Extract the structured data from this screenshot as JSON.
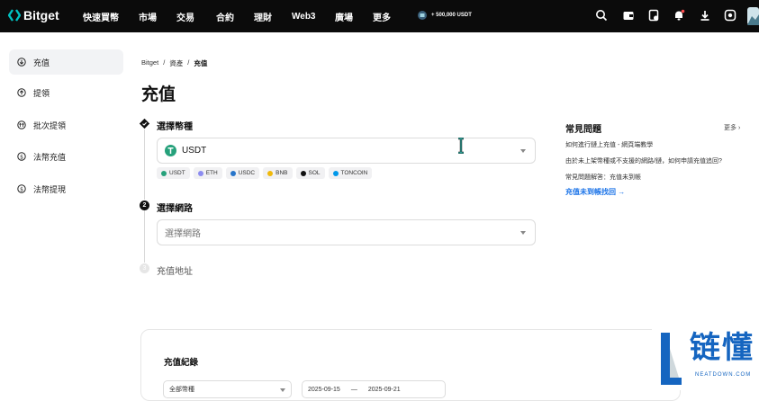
{
  "colors": {
    "topbar_bg": "#0b0b0b",
    "accent": "#00c2c2",
    "usdt": "#26a17b",
    "link": "#1a73e8",
    "watermark": "#1565c0"
  },
  "topbar": {
    "logo_text": "Bitget",
    "nav": [
      "快速買幣",
      "市場",
      "交易",
      "合約",
      "理財",
      "Web3",
      "廣場",
      "更多"
    ],
    "promo": "+ 500,000 USDT",
    "icons": [
      "search-icon",
      "wallet-icon",
      "orders-icon",
      "bell-icon",
      "download-icon",
      "globe-icon",
      "avatar"
    ]
  },
  "sidebar": {
    "items": [
      {
        "label": "充值",
        "icon": "deposit-icon"
      },
      {
        "label": "提領",
        "icon": "withdraw-icon"
      },
      {
        "label": "批次提領",
        "icon": "batch-withdraw-icon"
      },
      {
        "label": "法幣充值",
        "icon": "fiat-deposit-icon"
      },
      {
        "label": "法幣提現",
        "icon": "fiat-withdraw-icon"
      }
    ]
  },
  "breadcrumb": {
    "items": [
      "Bitget",
      "資產",
      "充值"
    ]
  },
  "page_title": "充值",
  "steps": {
    "coin": {
      "label": "選擇幣種",
      "selected": "USDT",
      "chips": [
        {
          "label": "USDT",
          "color": "#26a17b"
        },
        {
          "label": "ETH",
          "color": "#8c8cf0"
        },
        {
          "label": "USDC",
          "color": "#2775ca"
        },
        {
          "label": "BNB",
          "color": "#f0b90b"
        },
        {
          "label": "SOL",
          "color": "#111111"
        },
        {
          "label": "TONCOIN",
          "color": "#0098ea"
        }
      ]
    },
    "network": {
      "label": "選擇網路",
      "placeholder": "選擇網路"
    },
    "address": {
      "label": "充值地址"
    }
  },
  "faq": {
    "title": "常見問題",
    "more": "更多 ›",
    "items": [
      "如何進行鏈上充值 - 網頁端教學",
      "由於未上架幣種或不支援的網路/鏈，如何申請充值追回?",
      "常見問題解答：充值未到帳"
    ],
    "link": "充值未到帳找回 →"
  },
  "records": {
    "title": "充值紀錄",
    "coin_filter": "全部幣種",
    "date_from": "2025-09-15",
    "date_sep": "—",
    "date_to": "2025-09-21"
  },
  "watermark": {
    "glyph": "L",
    "text": "链懂",
    "sub": "NEATDOWN.COM"
  }
}
